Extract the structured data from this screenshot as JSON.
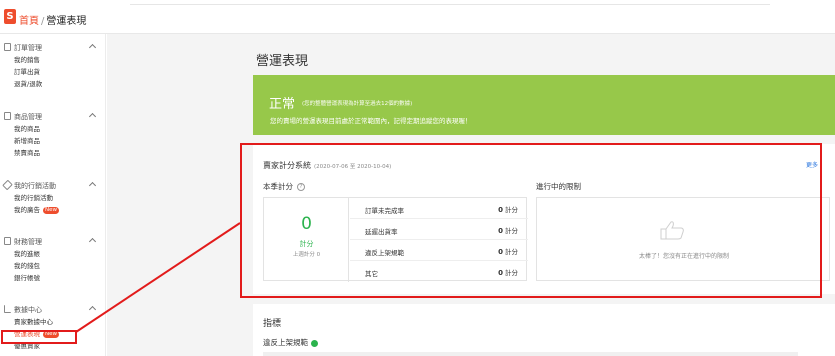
{
  "header": {
    "home": "首頁",
    "separator": "/",
    "current": "營運表現"
  },
  "sidebar": {
    "sections": [
      {
        "title": "訂單管理",
        "items": [
          "我的銷售",
          "訂單出貨",
          "退貨/退款"
        ]
      },
      {
        "title": "商品管理",
        "items": [
          "我的商品",
          "新增商品",
          "禁賣商品"
        ]
      },
      {
        "title": "我的行銷活動",
        "items": [
          "我的行銷活動",
          "我的廣告"
        ]
      },
      {
        "title": "財務管理",
        "items": [
          "我的進帳",
          "我的錢包",
          "銀行帳號"
        ]
      },
      {
        "title": "數據中心",
        "items": [
          "賣家數據中心",
          "營運表現",
          "優惠賣家"
        ]
      }
    ],
    "badge": "New"
  },
  "main": {
    "page_title": "營運表現",
    "status": {
      "word": "正常",
      "note": "(您的整體營運表現為計算至過去12個的數據)",
      "description": "您的賣場的營運表現目前處於正常範圍內，記得定期追蹤您的表現喔！"
    },
    "score_card": {
      "title": "賣家計分系統",
      "date_range": "(2020-07-06 至 2020-10-04)",
      "more": "更多",
      "quarter_label": "本季計分",
      "help": "?",
      "score": "0",
      "score_unit": "計分",
      "prev_score": "上週計分 0",
      "metrics": [
        {
          "name": "訂單未完成率",
          "value": "0",
          "unit": "計分"
        },
        {
          "name": "延遲出貨率",
          "value": "0",
          "unit": "計分"
        },
        {
          "name": "違反上架規範",
          "value": "0",
          "unit": "計分"
        },
        {
          "name": "其它",
          "value": "0",
          "unit": "計分"
        }
      ],
      "limits_label": "進行中的限制",
      "limits_empty": "太棒了！您沒有正在進行中的限制"
    },
    "metrics_card": {
      "title": "指標",
      "violation": "違反上架規範"
    }
  },
  "colors": {
    "brand": "#ee4d2d",
    "status_green": "#97c84a",
    "score_green": "#2bb34d",
    "highlight_red": "#e21b1b",
    "link_blue": "#2673dd"
  }
}
